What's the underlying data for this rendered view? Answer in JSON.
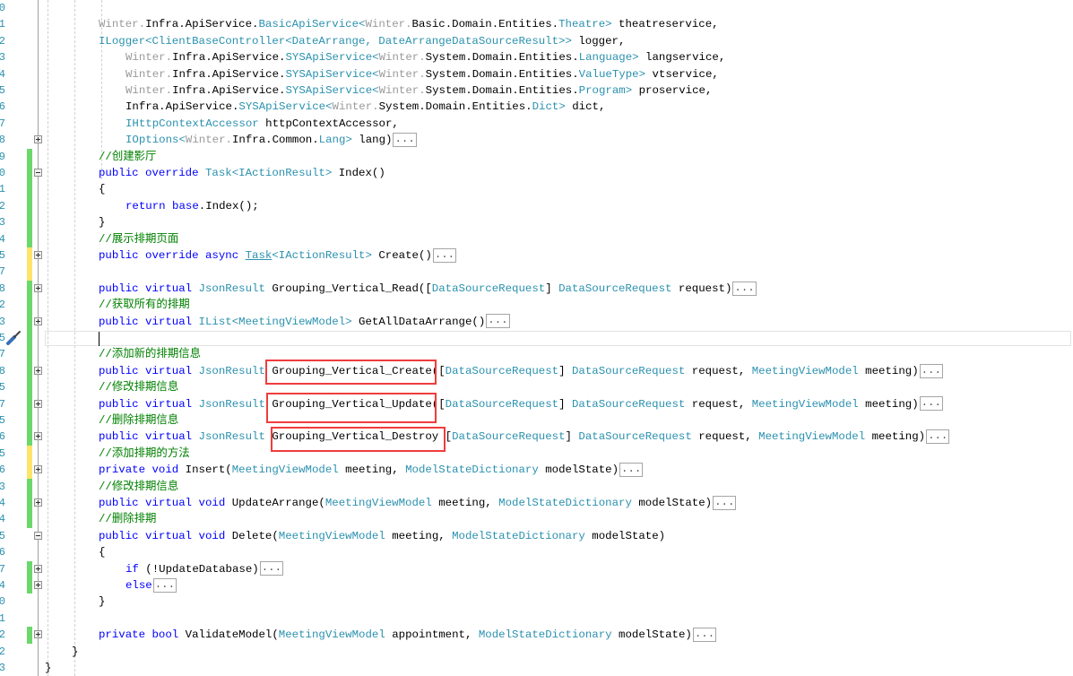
{
  "editor": {
    "collapsed_marker": "...",
    "change_colors": {
      "green": "#6bd86b",
      "yellow": "#ffe46b"
    },
    "highlight_color": "#f03c3c",
    "current_line": 20,
    "highlighted_methods": [
      "Grouping_Vertical_Create",
      "Grouping_Vertical_Update",
      "Grouping_Vertical_Destroy"
    ],
    "lines": [
      {
        "n": "0",
        "indent": 0,
        "tokens": []
      },
      {
        "n": "1",
        "indent": 2,
        "tokens": [
          [
            "g",
            "Winter."
          ],
          [
            "p",
            "Infra.ApiService."
          ],
          [
            "t",
            "BasicApiService<"
          ],
          [
            "g",
            "Winter."
          ],
          [
            "p",
            "Basic.Domain.Entities."
          ],
          [
            "t",
            "Theatre>"
          ],
          [
            "p",
            " theatreservice,"
          ]
        ]
      },
      {
        "n": "2",
        "indent": 2,
        "tokens": [
          [
            "t",
            "ILogger<ClientBaseController<DateArrange, DateArrangeDataSourceResult>>"
          ],
          [
            "p",
            " logger,"
          ]
        ]
      },
      {
        "n": "3",
        "indent": 3,
        "tokens": [
          [
            "g",
            "Winter."
          ],
          [
            "p",
            "Infra.ApiService."
          ],
          [
            "t",
            "SYSApiService<"
          ],
          [
            "g",
            "Winter."
          ],
          [
            "p",
            "System.Domain.Entities."
          ],
          [
            "t",
            "Language>"
          ],
          [
            "p",
            " langservice,"
          ]
        ]
      },
      {
        "n": "4",
        "indent": 3,
        "tokens": [
          [
            "g",
            "Winter."
          ],
          [
            "p",
            "Infra.ApiService."
          ],
          [
            "t",
            "SYSApiService<"
          ],
          [
            "g",
            "Winter."
          ],
          [
            "p",
            "System.Domain.Entities."
          ],
          [
            "t",
            "ValueType>"
          ],
          [
            "p",
            " vtservice,"
          ]
        ]
      },
      {
        "n": "5",
        "indent": 3,
        "tokens": [
          [
            "g",
            "Winter."
          ],
          [
            "p",
            "Infra.ApiService."
          ],
          [
            "t",
            "SYSApiService<"
          ],
          [
            "g",
            "Winter."
          ],
          [
            "p",
            "System.Domain.Entities."
          ],
          [
            "t",
            "Program>"
          ],
          [
            "p",
            " proservice,"
          ]
        ]
      },
      {
        "n": "6",
        "indent": 3,
        "tokens": [
          [
            "p",
            "Infra.ApiService."
          ],
          [
            "t",
            "SYSApiService<"
          ],
          [
            "g",
            "Winter."
          ],
          [
            "p",
            "System.Domain.Entities."
          ],
          [
            "t",
            "Dict>"
          ],
          [
            "p",
            " dict,"
          ]
        ]
      },
      {
        "n": "7",
        "indent": 3,
        "tokens": [
          [
            "t",
            "IHttpContextAccessor"
          ],
          [
            "p",
            " httpContextAccessor,"
          ]
        ]
      },
      {
        "n": "8",
        "indent": 3,
        "fold": "plus",
        "collapsed": true,
        "tokens": [
          [
            "t",
            "IOptions<"
          ],
          [
            "g",
            "Winter."
          ],
          [
            "p",
            "Infra.Common."
          ],
          [
            "t",
            "Lang>"
          ],
          [
            "p",
            " lang)"
          ]
        ]
      },
      {
        "n": "9",
        "indent": 2,
        "bar": "green",
        "tokens": [
          [
            "c",
            "//创建影厅"
          ]
        ]
      },
      {
        "n": "0",
        "indent": 2,
        "bar": "green",
        "fold": "minus",
        "tokens": [
          [
            "k",
            "public override "
          ],
          [
            "t",
            "Task<IActionResult>"
          ],
          [
            "p",
            " Index()"
          ]
        ]
      },
      {
        "n": "1",
        "indent": 2,
        "bar": "green",
        "tokens": [
          [
            "p",
            "{"
          ]
        ]
      },
      {
        "n": "2",
        "indent": 3,
        "bar": "green",
        "tokens": [
          [
            "k",
            "return base"
          ],
          [
            "p",
            ".Index();"
          ]
        ]
      },
      {
        "n": "3",
        "indent": 2,
        "bar": "green",
        "tokens": [
          [
            "p",
            "}"
          ]
        ]
      },
      {
        "n": "4",
        "indent": 2,
        "bar": "green",
        "tokens": [
          [
            "c",
            "//展示排期页面"
          ]
        ]
      },
      {
        "n": "5",
        "indent": 2,
        "bar": "yellow",
        "fold": "plus",
        "collapsed": true,
        "tokens": [
          [
            "k",
            "public override async "
          ],
          [
            "tu",
            "Task"
          ],
          [
            "t",
            "<IActionResult>"
          ],
          [
            "p",
            " Create()"
          ]
        ]
      },
      {
        "n": "7",
        "indent": 2,
        "bar": "yellow",
        "tokens": []
      },
      {
        "n": "8",
        "indent": 2,
        "bar": "green",
        "fold": "plus",
        "collapsed": true,
        "tokens": [
          [
            "k",
            "public virtual "
          ],
          [
            "t",
            "JsonResult"
          ],
          [
            "p",
            " Grouping_Vertical_Read(["
          ],
          [
            "t",
            "DataSourceRequest"
          ],
          [
            "p",
            "] "
          ],
          [
            "t",
            "DataSourceRequest"
          ],
          [
            "p",
            " request)"
          ]
        ]
      },
      {
        "n": "2",
        "indent": 2,
        "bar": "green",
        "tokens": [
          [
            "c",
            "//获取所有的排期"
          ]
        ]
      },
      {
        "n": "3",
        "indent": 2,
        "bar": "green",
        "fold": "plus",
        "collapsed": true,
        "tokens": [
          [
            "k",
            "public virtual "
          ],
          [
            "t",
            "IList<MeetingViewModel>"
          ],
          [
            "p",
            " GetAllDataArrange()"
          ]
        ]
      },
      {
        "n": "5",
        "indent": 2,
        "bar": "green",
        "tokens": []
      },
      {
        "n": "7",
        "indent": 2,
        "bar": "green",
        "tokens": [
          [
            "c",
            "//添加新的排期信息"
          ]
        ]
      },
      {
        "n": "8",
        "indent": 2,
        "bar": "green",
        "fold": "plus",
        "collapsed": true,
        "tokens": [
          [
            "k",
            "public virtual "
          ],
          [
            "t",
            "JsonResult"
          ],
          [
            "p",
            " Grouping_Vertical_Create(["
          ],
          [
            "t",
            "DataSourceRequest"
          ],
          [
            "p",
            "] "
          ],
          [
            "t",
            "DataSourceRequest"
          ],
          [
            "p",
            " request, "
          ],
          [
            "t",
            "MeetingViewModel"
          ],
          [
            "p",
            " meeting)"
          ]
        ]
      },
      {
        "n": "5",
        "indent": 2,
        "bar": "green",
        "tokens": [
          [
            "c",
            "//修改排期信息"
          ]
        ]
      },
      {
        "n": "7",
        "indent": 2,
        "bar": "green",
        "fold": "plus",
        "collapsed": true,
        "tokens": [
          [
            "k",
            "public virtual "
          ],
          [
            "t",
            "JsonResult"
          ],
          [
            "p",
            " Grouping_Vertical_Update(["
          ],
          [
            "t",
            "DataSourceRequest"
          ],
          [
            "p",
            "] "
          ],
          [
            "t",
            "DataSourceRequest"
          ],
          [
            "p",
            " request, "
          ],
          [
            "t",
            "MeetingViewModel"
          ],
          [
            "p",
            " meeting)"
          ]
        ]
      },
      {
        "n": "5",
        "indent": 2,
        "bar": "green",
        "tokens": [
          [
            "c",
            "//删除排期信息"
          ]
        ]
      },
      {
        "n": "6",
        "indent": 2,
        "bar": "green",
        "fold": "plus",
        "collapsed": true,
        "tokens": [
          [
            "k",
            "public virtual "
          ],
          [
            "t",
            "JsonResult"
          ],
          [
            "p",
            " Grouping_Vertical_Destroy ["
          ],
          [
            "t",
            "DataSourceRequest"
          ],
          [
            "p",
            "] "
          ],
          [
            "t",
            "DataSourceRequest"
          ],
          [
            "p",
            " request, "
          ],
          [
            "t",
            "MeetingViewModel"
          ],
          [
            "p",
            " meeting)"
          ]
        ]
      },
      {
        "n": "5",
        "indent": 2,
        "bar": "yellow",
        "tokens": [
          [
            "c",
            "//添加排期的方法"
          ]
        ]
      },
      {
        "n": "6",
        "indent": 2,
        "bar": "yellow",
        "fold": "plus",
        "collapsed": true,
        "tokens": [
          [
            "k",
            "private void "
          ],
          [
            "p",
            "Insert("
          ],
          [
            "t",
            "MeetingViewModel"
          ],
          [
            "p",
            " meeting, "
          ],
          [
            "t",
            "ModelStateDictionary"
          ],
          [
            "p",
            " modelState)"
          ]
        ]
      },
      {
        "n": "3",
        "indent": 2,
        "bar": "green",
        "tokens": [
          [
            "c",
            "//修改排期信息"
          ]
        ]
      },
      {
        "n": "4",
        "indent": 2,
        "bar": "green",
        "fold": "plus",
        "collapsed": true,
        "tokens": [
          [
            "k",
            "public virtual void "
          ],
          [
            "p",
            "UpdateArrange("
          ],
          [
            "t",
            "MeetingViewModel"
          ],
          [
            "p",
            " meeting, "
          ],
          [
            "t",
            "ModelStateDictionary"
          ],
          [
            "p",
            " modelState)"
          ]
        ]
      },
      {
        "n": "4",
        "indent": 2,
        "bar": "green",
        "tokens": [
          [
            "c",
            "//删除排期"
          ]
        ]
      },
      {
        "n": "5",
        "indent": 2,
        "fold": "minus",
        "tokens": [
          [
            "k",
            "public virtual void "
          ],
          [
            "p",
            "Delete("
          ],
          [
            "t",
            "MeetingViewModel"
          ],
          [
            "p",
            " meeting, "
          ],
          [
            "t",
            "ModelStateDictionary"
          ],
          [
            "p",
            " modelState)"
          ]
        ]
      },
      {
        "n": "6",
        "indent": 2,
        "tokens": [
          [
            "p",
            "{"
          ]
        ]
      },
      {
        "n": "7",
        "indent": 3,
        "bar": "green",
        "fold": "plus",
        "collapsed": true,
        "tokens": [
          [
            "k",
            "if"
          ],
          [
            "p",
            " (!UpdateDatabase)"
          ]
        ]
      },
      {
        "n": "4",
        "indent": 3,
        "bar": "green",
        "fold": "plus",
        "collapsed": true,
        "tokens": [
          [
            "k",
            "else"
          ]
        ]
      },
      {
        "n": "0",
        "indent": 2,
        "tokens": [
          [
            "p",
            "}"
          ]
        ]
      },
      {
        "n": "1",
        "indent": 2,
        "tokens": []
      },
      {
        "n": "2",
        "indent": 2,
        "bar": "green",
        "fold": "plus",
        "collapsed": true,
        "tokens": [
          [
            "k",
            "private bool "
          ],
          [
            "p",
            "ValidateModel("
          ],
          [
            "t",
            "MeetingViewModel"
          ],
          [
            "p",
            " appointment, "
          ],
          [
            "t",
            "ModelStateDictionary"
          ],
          [
            "p",
            " modelState)"
          ]
        ]
      },
      {
        "n": "2",
        "indent": 1,
        "tokens": [
          [
            "p",
            "}"
          ]
        ]
      },
      {
        "n": "3",
        "indent": 0,
        "tokens": [
          [
            "p",
            "}"
          ]
        ]
      }
    ]
  }
}
